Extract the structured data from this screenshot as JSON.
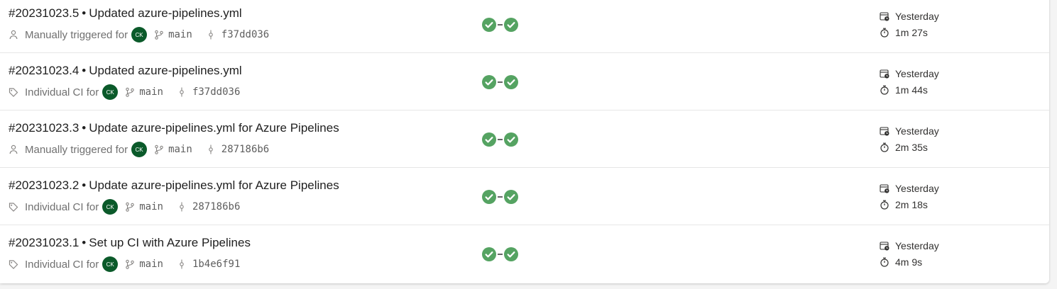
{
  "colors": {
    "success": "#55a362",
    "avatar_bg": "#0b5a2a"
  },
  "runs": [
    {
      "run_id": "#20231023.5",
      "separator": "•",
      "message": "Updated azure-pipelines.yml",
      "trigger_icon": "person-icon",
      "trigger": "Manually triggered for",
      "avatar_initials": "CK",
      "branch": "main",
      "commit": "f37dd036",
      "stages": [
        "success",
        "success"
      ],
      "date_label": "Yesterday",
      "duration": "1m 27s"
    },
    {
      "run_id": "#20231023.4",
      "separator": "•",
      "message": "Updated azure-pipelines.yml",
      "trigger_icon": "tag-icon",
      "trigger": "Individual CI for",
      "avatar_initials": "CK",
      "branch": "main",
      "commit": "f37dd036",
      "stages": [
        "success",
        "success"
      ],
      "date_label": "Yesterday",
      "duration": "1m 44s"
    },
    {
      "run_id": "#20231023.3",
      "separator": "•",
      "message": "Update azure-pipelines.yml for Azure Pipelines",
      "trigger_icon": "person-icon",
      "trigger": "Manually triggered for",
      "avatar_initials": "CK",
      "branch": "main",
      "commit": "287186b6",
      "stages": [
        "success",
        "success"
      ],
      "date_label": "Yesterday",
      "duration": "2m 35s"
    },
    {
      "run_id": "#20231023.2",
      "separator": "•",
      "message": "Update azure-pipelines.yml for Azure Pipelines",
      "trigger_icon": "tag-icon",
      "trigger": "Individual CI for",
      "avatar_initials": "CK",
      "branch": "main",
      "commit": "287186b6",
      "stages": [
        "success",
        "success"
      ],
      "date_label": "Yesterday",
      "duration": "2m 18s"
    },
    {
      "run_id": "#20231023.1",
      "separator": "•",
      "message": "Set up CI with Azure Pipelines",
      "trigger_icon": "tag-icon",
      "trigger": "Individual CI for",
      "avatar_initials": "CK",
      "branch": "main",
      "commit": "1b4e6f91",
      "stages": [
        "success",
        "success"
      ],
      "date_label": "Yesterday",
      "duration": "4m 9s"
    }
  ]
}
